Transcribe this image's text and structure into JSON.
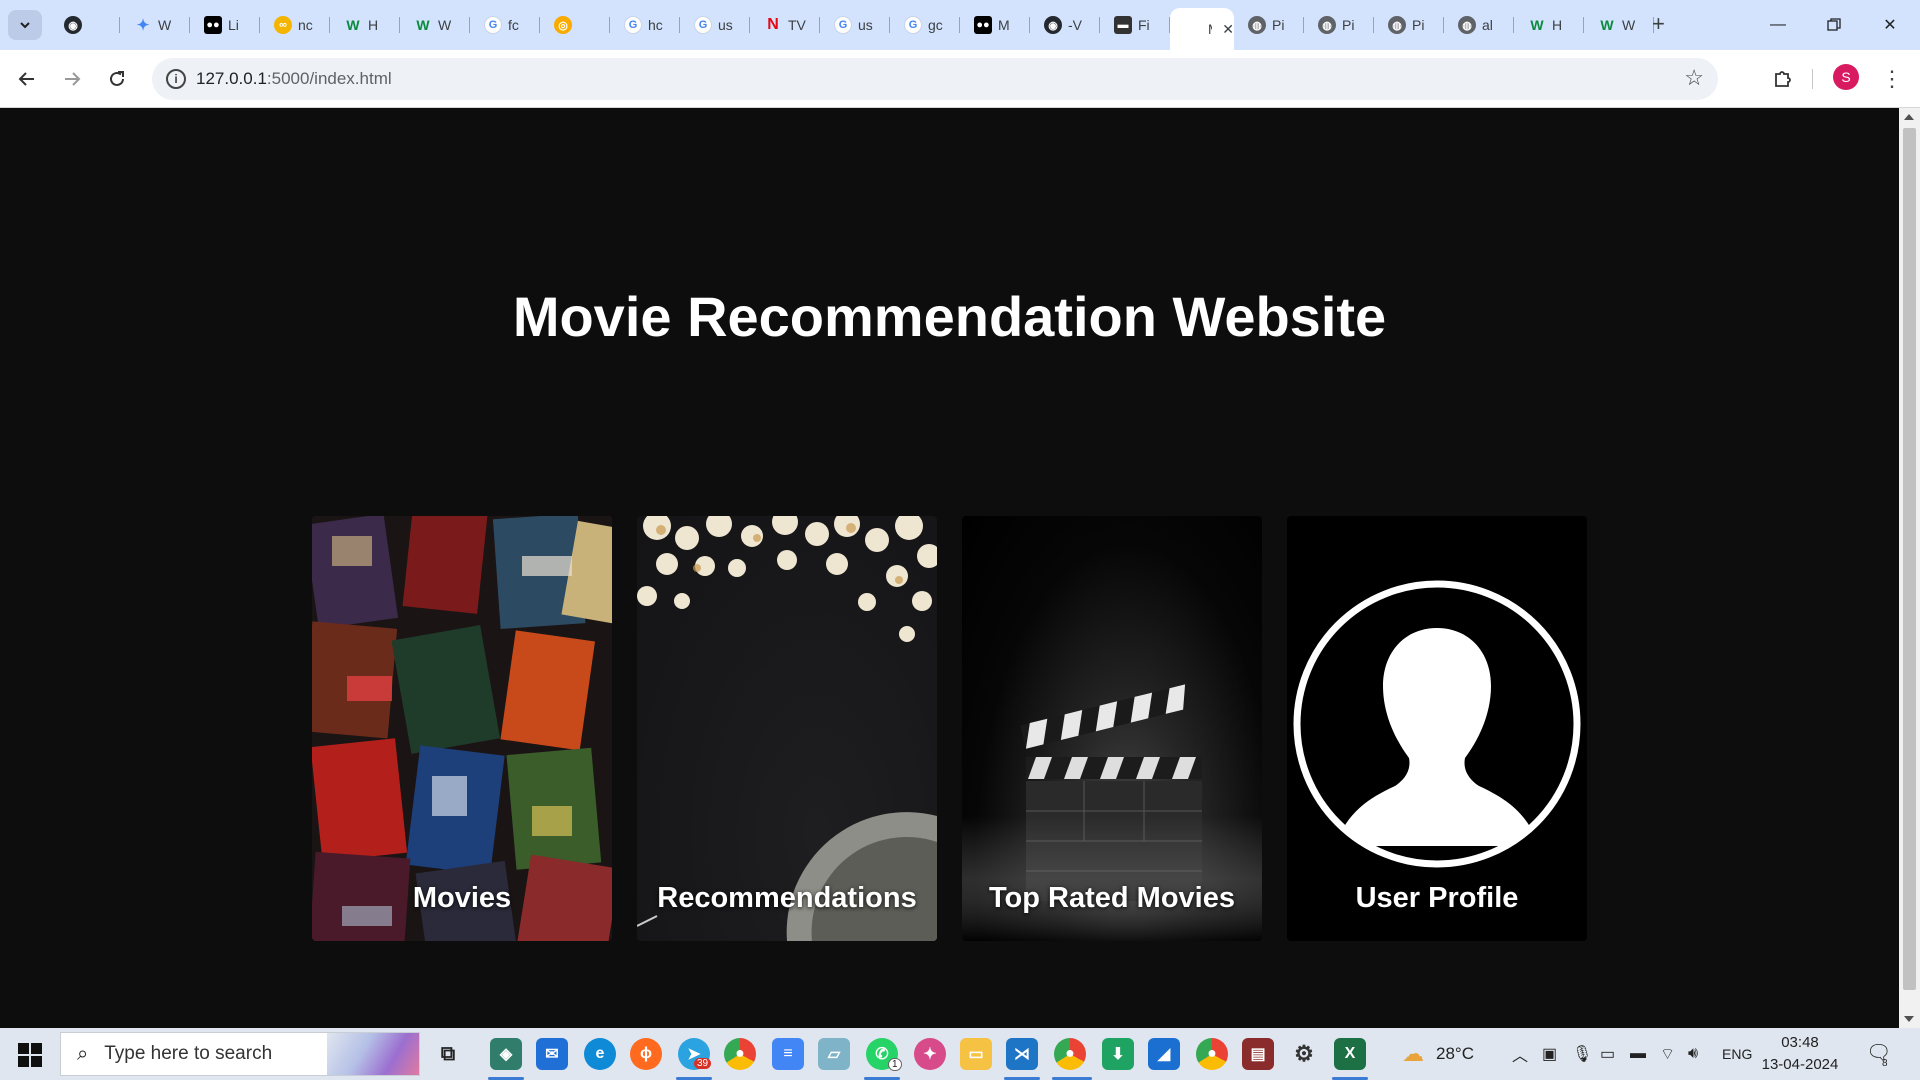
{
  "browser": {
    "tabs": [
      {
        "title": "",
        "icon": "github-icon",
        "color": "#24292f",
        "glyph": "◉"
      },
      {
        "title": "W",
        "icon": "gemini-icon",
        "color": "#4285f4",
        "glyph": "✦"
      },
      {
        "title": "Li",
        "icon": "medium-icon",
        "color": "#000000",
        "glyph": "●●"
      },
      {
        "title": "nc",
        "icon": "link-icon",
        "color": "#f4b400",
        "glyph": "∞"
      },
      {
        "title": "H",
        "icon": "wordpress-icon",
        "color": "#0a8a3c",
        "glyph": "W"
      },
      {
        "title": "W",
        "icon": "wordpress-icon",
        "color": "#0a8a3c",
        "glyph": "W"
      },
      {
        "title": "fc",
        "icon": "google-icon",
        "color": "#4285f4",
        "glyph": "G"
      },
      {
        "title": "",
        "icon": "colab-icon",
        "color": "#f9ab00",
        "glyph": "◎"
      },
      {
        "title": "hc",
        "icon": "google-icon",
        "color": "#4285f4",
        "glyph": "G"
      },
      {
        "title": "us",
        "icon": "google-icon",
        "color": "#4285f4",
        "glyph": "G"
      },
      {
        "title": "TV",
        "icon": "netflix-icon",
        "color": "#e50914",
        "glyph": "N"
      },
      {
        "title": "us",
        "icon": "google-icon",
        "color": "#4285f4",
        "glyph": "G"
      },
      {
        "title": "gc",
        "icon": "google-icon",
        "color": "#4285f4",
        "glyph": "G"
      },
      {
        "title": "M",
        "icon": "medium-icon",
        "color": "#000000",
        "glyph": "●●"
      },
      {
        "title": "-V",
        "icon": "github-icon",
        "color": "#24292f",
        "glyph": "◉"
      },
      {
        "title": "Fi",
        "icon": "terminal-icon",
        "color": "#333333",
        "glyph": "▬"
      },
      {
        "title": "M",
        "icon": "page-icon",
        "color": "#5f6368",
        "glyph": "",
        "active": true
      },
      {
        "title": "Pi",
        "icon": "globe-icon",
        "color": "#5f6368",
        "glyph": "◍"
      },
      {
        "title": "Pi",
        "icon": "globe-icon",
        "color": "#5f6368",
        "glyph": "◍"
      },
      {
        "title": "Pi",
        "icon": "globe-icon",
        "color": "#5f6368",
        "glyph": "◍"
      },
      {
        "title": "al",
        "icon": "globe-icon",
        "color": "#5f6368",
        "glyph": "◍"
      },
      {
        "title": "H",
        "icon": "wordpress-icon",
        "color": "#0a8a3c",
        "glyph": "W"
      },
      {
        "title": "W",
        "icon": "wordpress-icon",
        "color": "#0a8a3c",
        "glyph": "W"
      }
    ],
    "url_host": "127.0.0.1",
    "url_path": ":5000/index.html",
    "profile_initial": "S"
  },
  "page": {
    "title": "Movie Recommendation Website",
    "cards": [
      {
        "label": "Movies"
      },
      {
        "label": "Recommendations"
      },
      {
        "label": "Top Rated Movies"
      },
      {
        "label": "User Profile"
      }
    ]
  },
  "taskbar": {
    "search_placeholder": "Type here to search",
    "weather": "28°C",
    "language": "ENG",
    "time": "03:48",
    "date": "13-04-2024",
    "telegram_badge": "39",
    "whatsapp_badge": "1",
    "notification_count": "8"
  }
}
